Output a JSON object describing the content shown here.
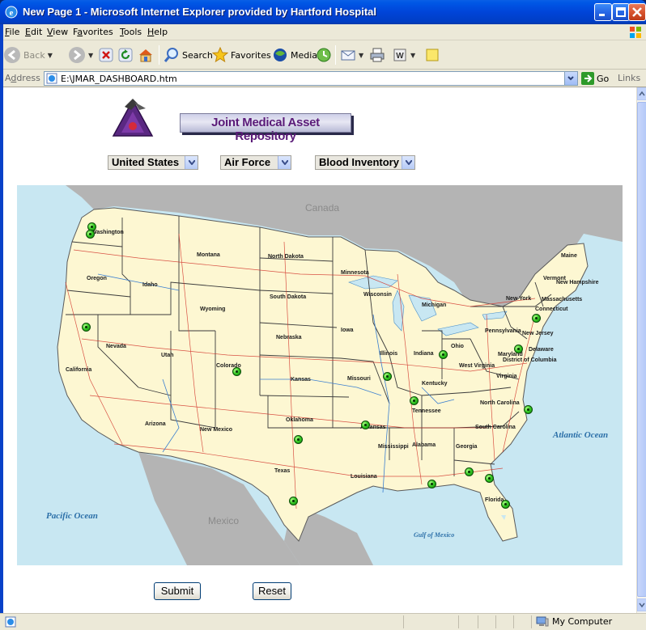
{
  "window": {
    "title": "New Page 1 - Microsoft Internet Explorer provided by Hartford Hospital"
  },
  "menu": {
    "items": [
      {
        "u": "F",
        "rest": "ile"
      },
      {
        "u": "E",
        "rest": "dit"
      },
      {
        "u": "V",
        "rest": "iew"
      },
      {
        "pre": "F",
        "u": "a",
        "rest": "vorites"
      },
      {
        "u": "T",
        "rest": "ools"
      },
      {
        "u": "H",
        "rest": "elp"
      }
    ]
  },
  "toolbar": {
    "back_label": "Back",
    "search_label": "Search",
    "favorites_label": "Favorites",
    "media_label": "Media"
  },
  "address": {
    "label_u": "d",
    "label_pre": "A",
    "label_rest": "dress",
    "value": "E:\\JMAR_DASHBOARD.htm",
    "go_label": "Go",
    "links_label": "Links"
  },
  "page": {
    "banner": "Joint Medical Asset Repository",
    "selects": {
      "country": "United States",
      "service": "Air Force",
      "inventory": "Blood Inventory"
    },
    "submit_label": "Submit",
    "reset_label": "Reset"
  },
  "map": {
    "country_labels": {
      "canada": "Canada",
      "mexico": "Mexico"
    },
    "oceans": {
      "pacific": "Pacific Ocean",
      "atlantic": "Atlantic Ocean",
      "gulf": "Gulf of Mexico"
    },
    "states": [
      "Washington",
      "Oregon",
      "California",
      "Nevada",
      "Idaho",
      "Montana",
      "Wyoming",
      "Utah",
      "Arizona",
      "Colorado",
      "New Mexico",
      "North Dakota",
      "South Dakota",
      "Nebraska",
      "Kansas",
      "Oklahoma",
      "Texas",
      "Minnesota",
      "Iowa",
      "Missouri",
      "Arkansas",
      "Louisiana",
      "Wisconsin",
      "Illinois",
      "Mississippi",
      "Michigan",
      "Indiana",
      "Kentucky",
      "Tennessee",
      "Alabama",
      "Ohio",
      "Georgia",
      "Florida",
      "South Carolina",
      "North Carolina",
      "Virginia",
      "West Virginia",
      "Pennsylvania",
      "New York",
      "Maryland",
      "Delaware",
      "New Jersey",
      "District of Columbia",
      "Connecticut",
      "Massachusetts",
      "Vermont",
      "New Hampshire",
      "Maine"
    ],
    "colors": {
      "land": "#fdf7d2",
      "water": "#c8e7f2",
      "foreign": "#b4b4b4",
      "marker": "#2fc41f"
    }
  },
  "status": {
    "zone_label": "My Computer"
  }
}
